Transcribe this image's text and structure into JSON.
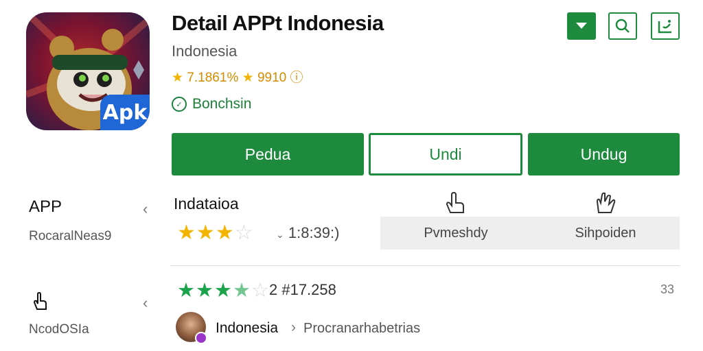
{
  "app": {
    "title": "Detail APPt Indonesia",
    "developer": "Indonesia",
    "rating_text": "7.1861%",
    "rating_text2": "9910",
    "install_label": "Bonchsin",
    "icon_badge": "Apk"
  },
  "top_icons": [
    "download-icon",
    "search-icon",
    "share-icon"
  ],
  "actions": {
    "primary1": "Pedua",
    "outline": "Undi",
    "primary2": "Undug"
  },
  "sidebar": {
    "item1_title": "APP",
    "item1_sub": "Rocaral​Neas9",
    "item2_sub": "NcodOSIa"
  },
  "ratings": {
    "section_title": "Indataioa",
    "stars": 3.5,
    "count_text": "1:8:39:)",
    "chip1_label": "Pvmeshdy",
    "chip2_label": "Sihpoiden"
  },
  "review": {
    "stars": 3.5,
    "count_text": "2  #17.258",
    "more_label": "33",
    "reviewer_name": "Indonesia",
    "reviewer_meta": "Procranarhabetrias"
  },
  "colors": {
    "accent_green": "#1e8a3e",
    "star_gold": "#f2b400",
    "star_green": "#1aa34a",
    "badge_blue": "#1f66d6"
  }
}
